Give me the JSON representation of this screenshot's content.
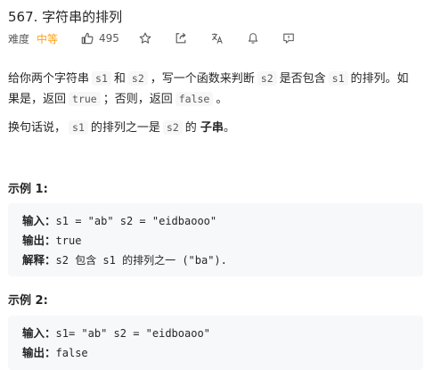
{
  "problem": {
    "title": "567. 字符串的排列",
    "difficulty_label": "难度",
    "difficulty_value": "中等",
    "likes": "495",
    "icons": [
      "thumbs-up-icon",
      "star-icon",
      "share-icon",
      "translate-icon",
      "bell-icon",
      "feedback-icon"
    ]
  },
  "description": {
    "p1_a": "给你两个字符串",
    "p1_s1": "s1",
    "p1_b": "和",
    "p1_s2": "s2",
    "p1_c": "，写一个函数来判断",
    "p1_s2b": "s2",
    "p1_d": "是否包含",
    "p1_s1b": "s1",
    "p1_e": "的排列。如",
    "p1_f": "果是，返回",
    "p1_true": "true",
    "p1_g": "；否则，返回",
    "p1_false": "false",
    "p1_h": "。",
    "p2_a": "换句话说，",
    "p2_s1": "s1",
    "p2_b": "的排列之一是",
    "p2_s2": "s2",
    "p2_c": "的",
    "p2_bold": "子串",
    "p2_d": "。"
  },
  "examples": [
    {
      "title": "示例 1:",
      "input_key": "输入：",
      "input_val": "s1 = \"ab\" s2 = \"eidbaooo\"",
      "output_key": "输出：",
      "output_val": "true",
      "explain_key": "解释：",
      "explain_val": "s2 包含 s1 的排列之一 (\"ba\")."
    },
    {
      "title": "示例 2:",
      "input_key": "输入：",
      "input_val": "s1= \"ab\" s2 = \"eidboaoo\"",
      "output_key": "输出：",
      "output_val": "false"
    }
  ],
  "colors": {
    "accent_medium": "#ffa116",
    "text": "#262626",
    "muted": "#595959",
    "code_bg": "#f7f8fa"
  }
}
